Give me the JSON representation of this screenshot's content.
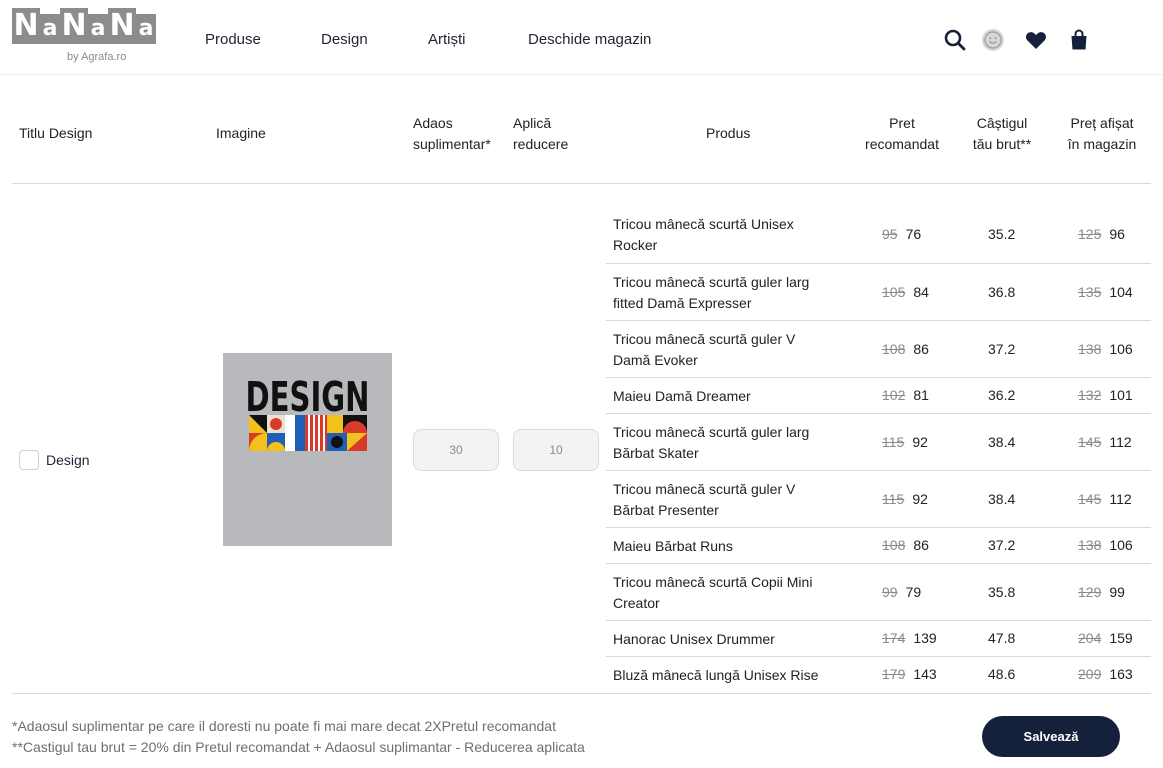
{
  "logo": {
    "letters": [
      "N",
      "a",
      "N",
      "a",
      "N",
      "a"
    ],
    "subtitle": "by Agrafa.ro"
  },
  "nav": [
    "Produse",
    "Design",
    "Artiști",
    "Deschide magazin"
  ],
  "header_icons": [
    "search-icon",
    "smiley-avatar-icon",
    "heart-icon",
    "shopping-bag-icon"
  ],
  "columns": {
    "title": "Titlu Design",
    "image": "Imagine",
    "extra_line1": "Adaos",
    "extra_line2": "suplimentar*",
    "discount_line1": "Aplică",
    "discount_line2": "reducere",
    "product": "Produs",
    "recommended_line1": "Pret",
    "recommended_line2": "recomandat",
    "earnings_line1": "Câștigul",
    "earnings_line2": "tău brut**",
    "shop_price_line1": "Preț afișat",
    "shop_price_line2": "în magazin"
  },
  "design": {
    "title": "Design",
    "image_text": "DESIGN",
    "extra_value": "30",
    "discount_value": "10"
  },
  "products": [
    {
      "name": "Tricou mânecă scurtă Unisex Rocker",
      "rec_old": "95",
      "rec_new": "76",
      "earnings": "35.2",
      "shop_old": "125",
      "shop_new": "96"
    },
    {
      "name": "Tricou mânecă scurtă guler larg fitted Damă Expresser",
      "rec_old": "105",
      "rec_new": "84",
      "earnings": "36.8",
      "shop_old": "135",
      "shop_new": "104"
    },
    {
      "name": "Tricou mânecă scurtă guler V Damă Evoker",
      "rec_old": "108",
      "rec_new": "86",
      "earnings": "37.2",
      "shop_old": "138",
      "shop_new": "106"
    },
    {
      "name": "Maieu Damă Dreamer",
      "rec_old": "102",
      "rec_new": "81",
      "earnings": "36.2",
      "shop_old": "132",
      "shop_new": "101"
    },
    {
      "name": "Tricou mânecă scurtă guler larg Bărbat Skater",
      "rec_old": "115",
      "rec_new": "92",
      "earnings": "38.4",
      "shop_old": "145",
      "shop_new": "112"
    },
    {
      "name": "Tricou mânecă scurtă guler V Bărbat Presenter",
      "rec_old": "115",
      "rec_new": "92",
      "earnings": "38.4",
      "shop_old": "145",
      "shop_new": "112"
    },
    {
      "name": "Maieu Bărbat Runs",
      "rec_old": "108",
      "rec_new": "86",
      "earnings": "37.2",
      "shop_old": "138",
      "shop_new": "106"
    },
    {
      "name": "Tricou mânecă scurtă Copii Mini Creator",
      "rec_old": "99",
      "rec_new": "79",
      "earnings": "35.8",
      "shop_old": "129",
      "shop_new": "99"
    },
    {
      "name": "Hanorac Unisex Drummer",
      "rec_old": "174",
      "rec_new": "139",
      "earnings": "47.8",
      "shop_old": "204",
      "shop_new": "159"
    },
    {
      "name": "Bluză mânecă lungă Unisex Rise",
      "rec_old": "179",
      "rec_new": "143",
      "earnings": "48.6",
      "shop_old": "209",
      "shop_new": "163"
    }
  ],
  "footer": {
    "note1": "*Adaosul suplimentar pe care il doresti nu poate fi mai mare decat 2XPretul recomandat",
    "note2": "**Castigul tau brut = 20% din Pretul recomandat + Adaosul suplimantar - Reducerea aplicata",
    "save_label": "Salvează"
  },
  "colors": {
    "primary": "#15203a",
    "logo_gray": "#8c8c8c",
    "image_bg": "#b7b9bc"
  }
}
